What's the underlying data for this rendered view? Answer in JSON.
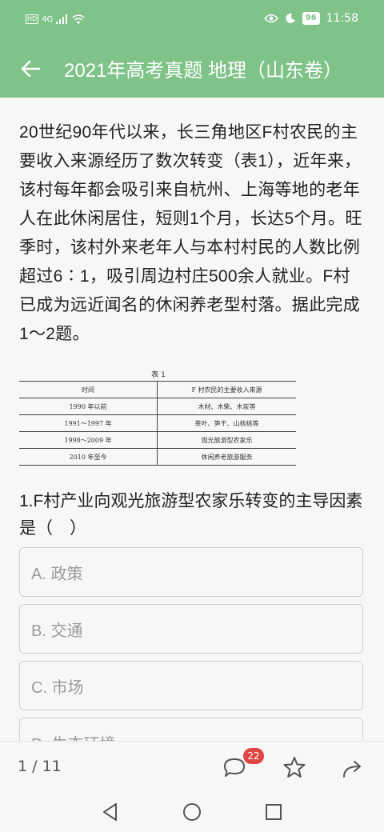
{
  "status": {
    "hd": "HD",
    "network": "4G",
    "battery": "96",
    "time": "11:58"
  },
  "header": {
    "title": "2021年高考真题 地理（山东卷）"
  },
  "passage": "20世纪90年代以来，长三角地区F村农民的主要收入来源经历了数次转变（表1），近年来，该村每年都会吸引来自杭州、上海等地的老年人在此休闲居住，短则1个月，长达5个月。旺季时，该村外来老年人与本村村民的人数比例超过6∶1，吸引周边村庄500余人就业。F村已成为远近闻名的休闲养老型村落。据此完成1～2题。",
  "table": {
    "caption": "表 1",
    "headers": [
      "时间",
      "F 村农民的主要收入来源"
    ],
    "rows": [
      [
        "1990 年以前",
        "木材、木柴、木炭等"
      ],
      [
        "1991～1997 年",
        "茶叶、笋干、山核桃等"
      ],
      [
        "1998～2009 年",
        "观光旅游型农家乐"
      ],
      [
        "2010 年至今",
        "休闲养老旅游服务"
      ]
    ]
  },
  "question": "1.F村产业向观光旅游型农家乐转变的主导因素是（　）",
  "options": [
    "A. 政策",
    "B. 交通",
    "C. 市场",
    "D. 生态环境"
  ],
  "bottom": {
    "pager": "1 / 11",
    "comment_count": "22"
  },
  "colors": {
    "accent": "#7fc389",
    "badge": "#e04545"
  }
}
